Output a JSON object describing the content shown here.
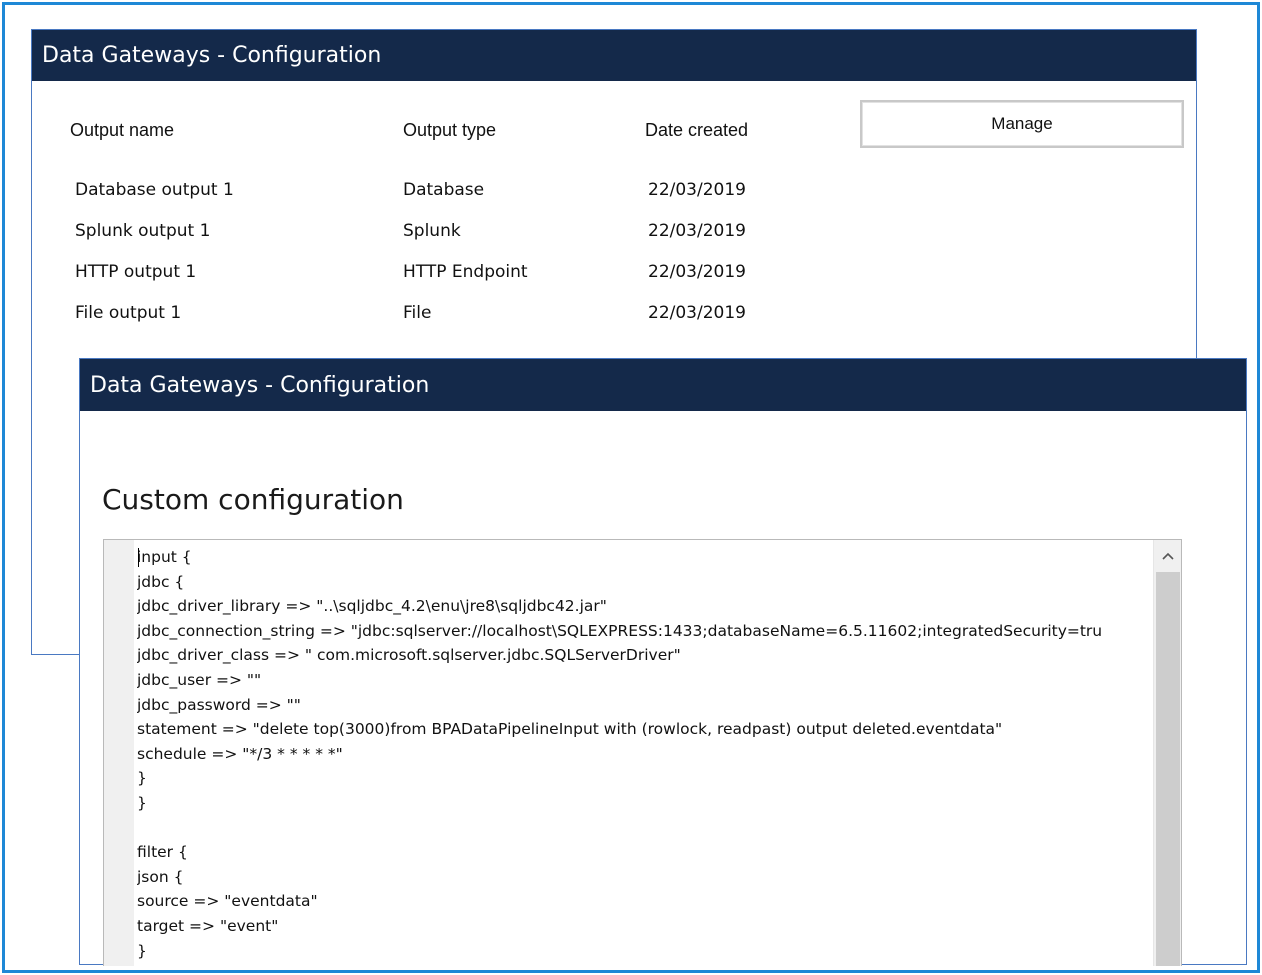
{
  "back_window": {
    "title": "Data Gateways - Configuration",
    "columns": {
      "name": "Output name",
      "type": "Output type",
      "date": "Date created"
    },
    "manage_label": "Manage",
    "rows": [
      {
        "name": "Database output 1",
        "type": "Database",
        "date": "22/03/2019"
      },
      {
        "name": "Splunk output 1",
        "type": "Splunk",
        "date": "22/03/2019"
      },
      {
        "name": "HTTP output 1",
        "type": "HTTP Endpoint",
        "date": "22/03/2019"
      },
      {
        "name": "File output 1",
        "type": "File",
        "date": "22/03/2019"
      }
    ]
  },
  "front_window": {
    "title": "Data Gateways - Configuration",
    "section_title": "Custom configuration",
    "code_lines": [
      "input {",
      "jdbc {",
      "jdbc_driver_library => \"..\\sqljdbc_4.2\\enu\\jre8\\sqljdbc42.jar\"",
      "jdbc_connection_string => \"jdbc:sqlserver://localhost\\SQLEXPRESS:1433;databaseName=6.5.11602;integratedSecurity=tru",
      "jdbc_driver_class => \" com.microsoft.sqlserver.jdbc.SQLServerDriver\"",
      "jdbc_user => \"\"",
      "jdbc_password => \"\"",
      "statement => \"delete top(3000)from BPADataPipelineInput with (rowlock, readpast) output deleted.eventdata\"",
      "schedule => \"*/3 * * * * *\"",
      "}",
      "}",
      "",
      "filter {",
      "json {",
      "source => \"eventdata\"",
      "target => \"event\"",
      "}"
    ]
  },
  "icons": {
    "scroll_up": "chevron-up-icon"
  },
  "colors": {
    "titlebar": "#14294a",
    "frame_border": "#1e88d6",
    "window_border": "#4a79c2"
  }
}
